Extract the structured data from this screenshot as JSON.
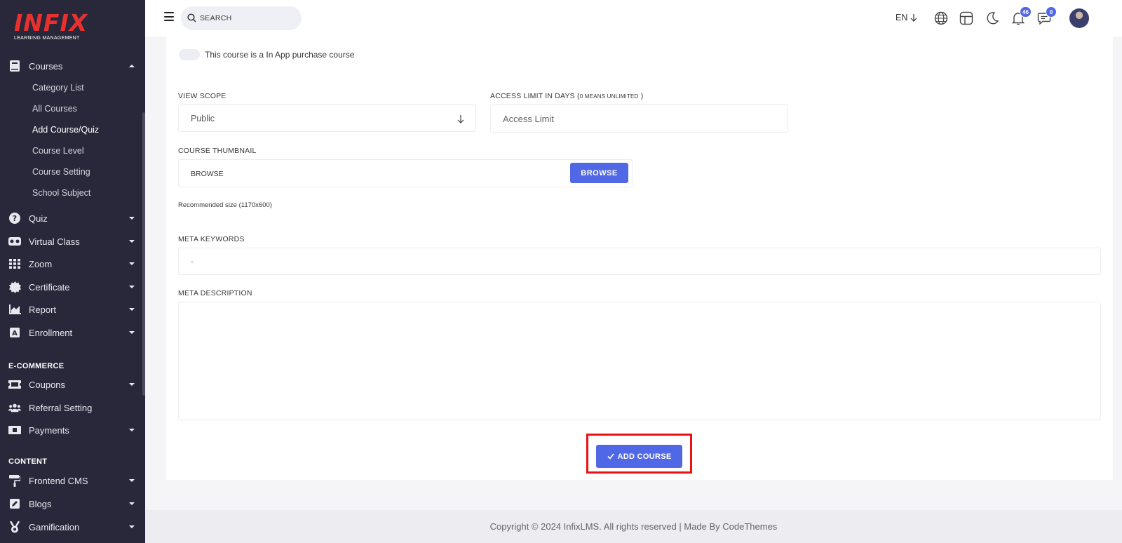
{
  "brand": {
    "name": "INFIX",
    "subtitle": "LEARNING MANAGEMENT"
  },
  "sidebar": {
    "courses": {
      "label": "Courses",
      "items": [
        "Category List",
        "All Courses",
        "Add Course/Quiz",
        "Course Level",
        "Course Setting",
        "School Subject"
      ],
      "active": "Add Course/Quiz"
    },
    "menu": [
      {
        "label": "Quiz",
        "icon": "question-circle-icon"
      },
      {
        "label": "Virtual Class",
        "icon": "vr-headset-icon"
      },
      {
        "label": "Zoom",
        "icon": "grid-icon"
      },
      {
        "label": "Certificate",
        "icon": "certificate-icon"
      },
      {
        "label": "Report",
        "icon": "chart-area-icon"
      },
      {
        "label": "Enrollment",
        "icon": "enrollment-icon"
      }
    ],
    "ecommerce_heading": "E-COMMERCE",
    "ecommerce": [
      {
        "label": "Coupons",
        "icon": "ticket-icon"
      },
      {
        "label": "Referral Setting",
        "icon": "users-icon"
      },
      {
        "label": "Payments",
        "icon": "money-icon"
      }
    ],
    "content_heading": "CONTENT",
    "content": [
      {
        "label": "Frontend CMS",
        "icon": "paint-roller-icon"
      },
      {
        "label": "Blogs",
        "icon": "edit-icon"
      },
      {
        "label": "Gamification",
        "icon": "medal-icon"
      }
    ]
  },
  "header": {
    "search_placeholder": "SEARCH",
    "language": "EN",
    "notifications_count": "46",
    "messages_count": "0"
  },
  "form": {
    "in_app_purchase_label": "This course is a In App purchase course",
    "view_scope_label": "VIEW SCOPE",
    "view_scope_value": "Public",
    "access_limit_label": "ACCESS LIMIT IN DAYS (",
    "access_limit_note": "0 MEANS UNLIMITED",
    "access_limit_close": " )",
    "access_limit_placeholder": "Access Limit",
    "thumbnail_label": "COURSE THUMBNAIL",
    "thumbnail_value": "BROWSE",
    "browse_button": "BROWSE",
    "thumbnail_hint": "Recommended size (1170x600)",
    "meta_keywords_label": "META KEYWORDS",
    "meta_keywords_placeholder": "-",
    "meta_description_label": "META DESCRIPTION",
    "submit_button": "ADD COURSE"
  },
  "footer": {
    "text": "Copyright © 2024 InfixLMS. All rights reserved | Made By CodeThemes"
  },
  "colors": {
    "sidebar": "#28283a",
    "accent": "#5168e6",
    "brand_red": "#e9302f",
    "highlight": "#ee1111"
  }
}
